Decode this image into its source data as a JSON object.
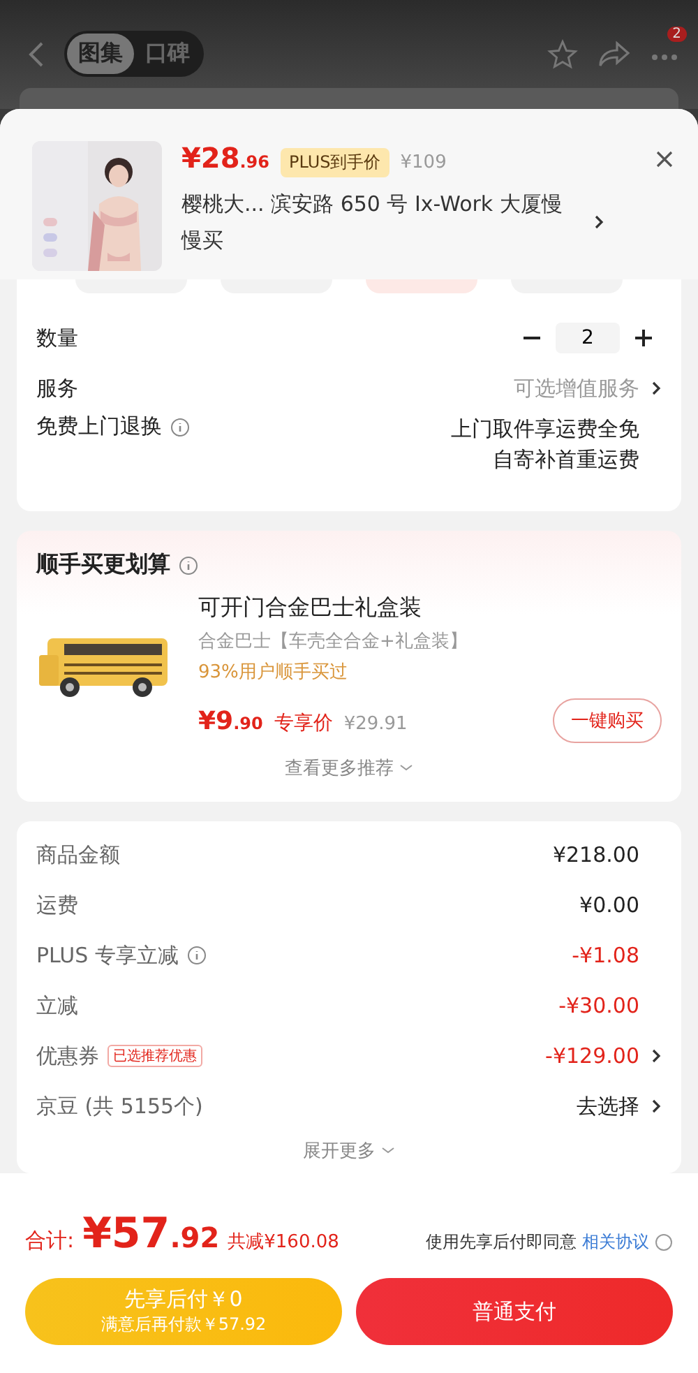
{
  "nav": {
    "tabs": [
      {
        "label": "图集",
        "selected": true
      },
      {
        "label": "口碑",
        "selected": false
      }
    ],
    "badge": "2"
  },
  "product": {
    "price_int": "¥28",
    "price_dec": ".96",
    "price_tag": "PLUS到手价",
    "original_price": "¥109",
    "address": "樱桃大...  滨安路 650 号 Ix-Work 大厦慢慢买"
  },
  "options": [
    {
      "label": "数量",
      "kind": "stepper",
      "value": "2"
    },
    {
      "label": "服务",
      "kind": "link",
      "value": "可选增值服务"
    },
    {
      "label": "免费上门退换",
      "kind": "info",
      "lines": [
        "上门取件享运费全免",
        "自寄补首重运费"
      ]
    }
  ],
  "addon": {
    "title": "顺手买更划算",
    "item": {
      "name": "可开门合金巴士礼盒装",
      "spec": "合金巴士【车壳全合金+礼盒装】",
      "note": "93%用户顺手买过",
      "price_int": "¥9",
      "price_dec": ".90",
      "price_tag": "专享价",
      "original_price": "¥29.91",
      "button": "一键购买"
    },
    "more": "查看更多推荐"
  },
  "summary": {
    "rows": [
      {
        "label": "商品金额",
        "value": "¥218.00",
        "kind": "plain",
        "info": false,
        "arrow": false
      },
      {
        "label": "运费",
        "value": "¥0.00",
        "kind": "plain",
        "info": false,
        "arrow": false
      },
      {
        "label": "PLUS 专享立减",
        "value": "-¥1.08",
        "kind": "discount",
        "info": true,
        "arrow": false
      },
      {
        "label": "立减",
        "value": "-¥30.00",
        "kind": "discount",
        "info": false,
        "arrow": false
      },
      {
        "label": "优惠券",
        "tag": "已选推荐优惠",
        "value": "-¥129.00",
        "kind": "discount",
        "info": false,
        "arrow": true
      },
      {
        "label": "京豆 (共 5155个)",
        "value": "去选择",
        "kind": "plain",
        "info": false,
        "arrow": true
      }
    ],
    "more": "展开更多"
  },
  "footer": {
    "total_label": "合计:",
    "total_int": "¥57",
    "total_dec": ".92",
    "saved": "共减¥160.08",
    "agreement": "使用先享后付即同意",
    "agreement_link": "相关协议",
    "pay_later": {
      "title": "先享后付￥0",
      "subtitle": "满意后再付款￥57.92"
    },
    "pay_now": "普通支付"
  }
}
